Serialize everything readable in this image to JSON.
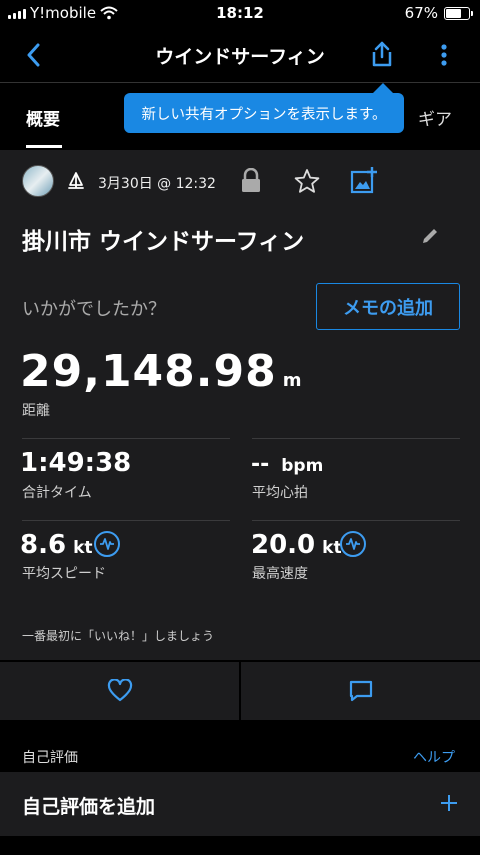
{
  "status_bar": {
    "carrier": "Y!mobile",
    "time": "18:12",
    "battery": "67%",
    "battery_level": 0.67
  },
  "nav": {
    "title": "ウインドサーフィン",
    "icons": [
      "back-chevron-icon",
      "share-icon",
      "more-vertical-icon"
    ]
  },
  "tabs": {
    "active": "概要",
    "gear": "ギア"
  },
  "tooltip": "新しい共有オプションを表示します。",
  "activity": {
    "date": "3月30日 @ 12:32",
    "name": "掛川市 ウインドサーフィン",
    "prompt": "いかがでしたか？",
    "memo_button": "メモの追加"
  },
  "stats": {
    "distance": {
      "value": "29,148.98",
      "unit": "m",
      "label": "距離"
    },
    "total_time": {
      "value": "1:49:38",
      "label": "合計タイム"
    },
    "avg_hr": {
      "value": "--",
      "unit": "bpm",
      "label": "平均心拍"
    },
    "avg_speed": {
      "value": "8.6",
      "unit": "kt",
      "label": "平均スピード"
    },
    "max_speed": {
      "value": "20.0",
      "unit": "kt",
      "label": "最高速度"
    }
  },
  "like_prompt": "一番最初に「いいね！」しましょう",
  "self_eval": {
    "header": "自己評価",
    "help": "ヘルプ",
    "add": "自己評価を追加"
  },
  "colors": {
    "accent": "#1a88e3",
    "card": "#1c1c1e",
    "background": "#000000"
  }
}
